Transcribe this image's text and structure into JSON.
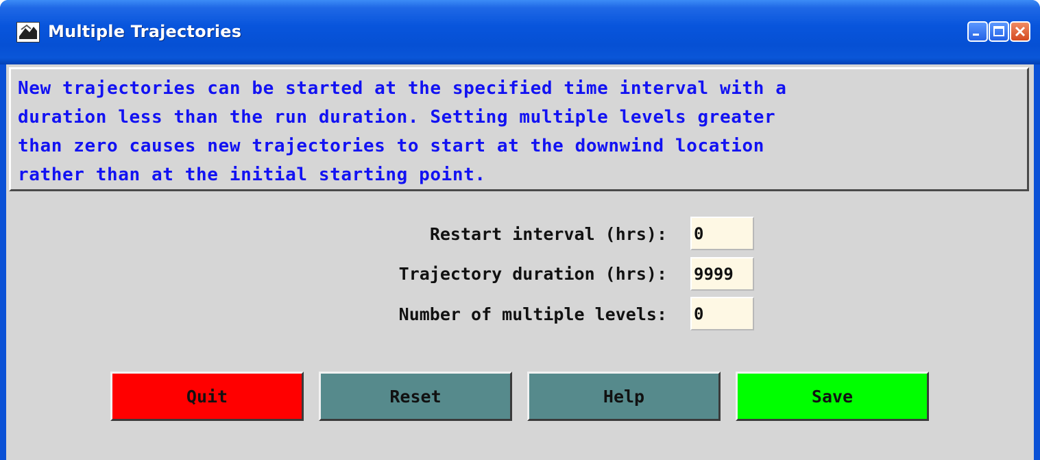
{
  "window": {
    "title": "Multiple Trajectories",
    "icon": "app-icon",
    "controls": [
      "minimize-icon",
      "maximize-icon",
      "close-icon"
    ]
  },
  "info": {
    "lines": [
      "New trajectories can be started at the specified time interval with a",
      "duration less than the run duration. Setting multiple levels greater",
      "than zero causes new trajectories to start at the downwind location",
      "rather than at the initial starting point."
    ],
    "color": "#1212f2"
  },
  "fields": [
    {
      "label": "Restart interval (hrs):",
      "value": "0"
    },
    {
      "label": "Trajectory duration (hrs):",
      "value": "9999"
    },
    {
      "label": "Number of multiple levels:",
      "value": "0"
    }
  ],
  "buttons": {
    "quit": "Quit",
    "reset": "Reset",
    "help": "Help",
    "save": "Save"
  },
  "colors": {
    "quit": "#ff0000",
    "reset": "#568a8c",
    "help": "#568a8c",
    "save": "#00ff00",
    "input_bg": "#fef8e4",
    "panel_bg": "#d6d6d6"
  }
}
